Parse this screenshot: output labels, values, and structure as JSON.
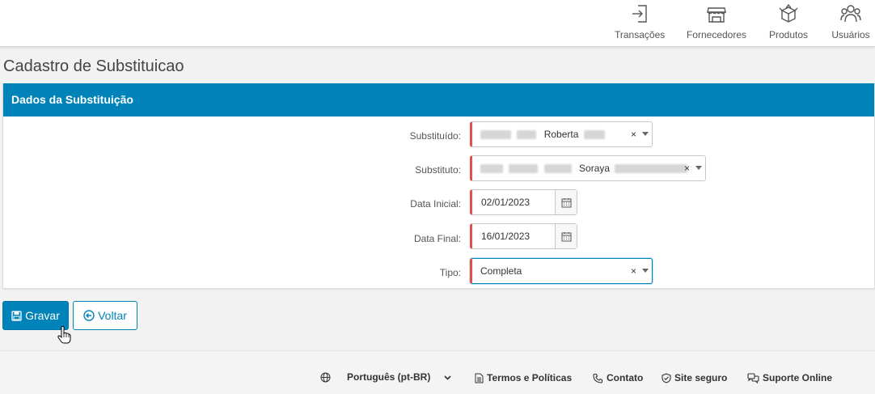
{
  "nav": {
    "items": [
      {
        "label": "Transações",
        "icon": "login-icon"
      },
      {
        "label": "Fornecedores",
        "icon": "store-icon"
      },
      {
        "label": "Produtos",
        "icon": "box-icon"
      },
      {
        "label": "Usuários",
        "icon": "users-icon"
      }
    ]
  },
  "page": {
    "title": "Cadastro de Substituicao"
  },
  "panel": {
    "header": "Dados da Substituição"
  },
  "form": {
    "substituido": {
      "label": "Substituído:",
      "value": "Roberta"
    },
    "substituto": {
      "label": "Substituto:",
      "value": "Soraya"
    },
    "data_inicial": {
      "label": "Data Inicial:",
      "value": "02/01/2023"
    },
    "data_final": {
      "label": "Data Final:",
      "value": "16/01/2023"
    },
    "tipo": {
      "label": "Tipo:",
      "value": "Completa"
    },
    "clear_symbol": "×"
  },
  "buttons": {
    "save": "Gravar",
    "back": "Voltar"
  },
  "footer": {
    "language": "Português (pt-BR)",
    "terms": "Termos e Políticas",
    "contact": "Contato",
    "secure": "Site seguro",
    "support": "Suporte Online"
  },
  "colors": {
    "primary": "#0083b8",
    "required": "#e05050"
  }
}
